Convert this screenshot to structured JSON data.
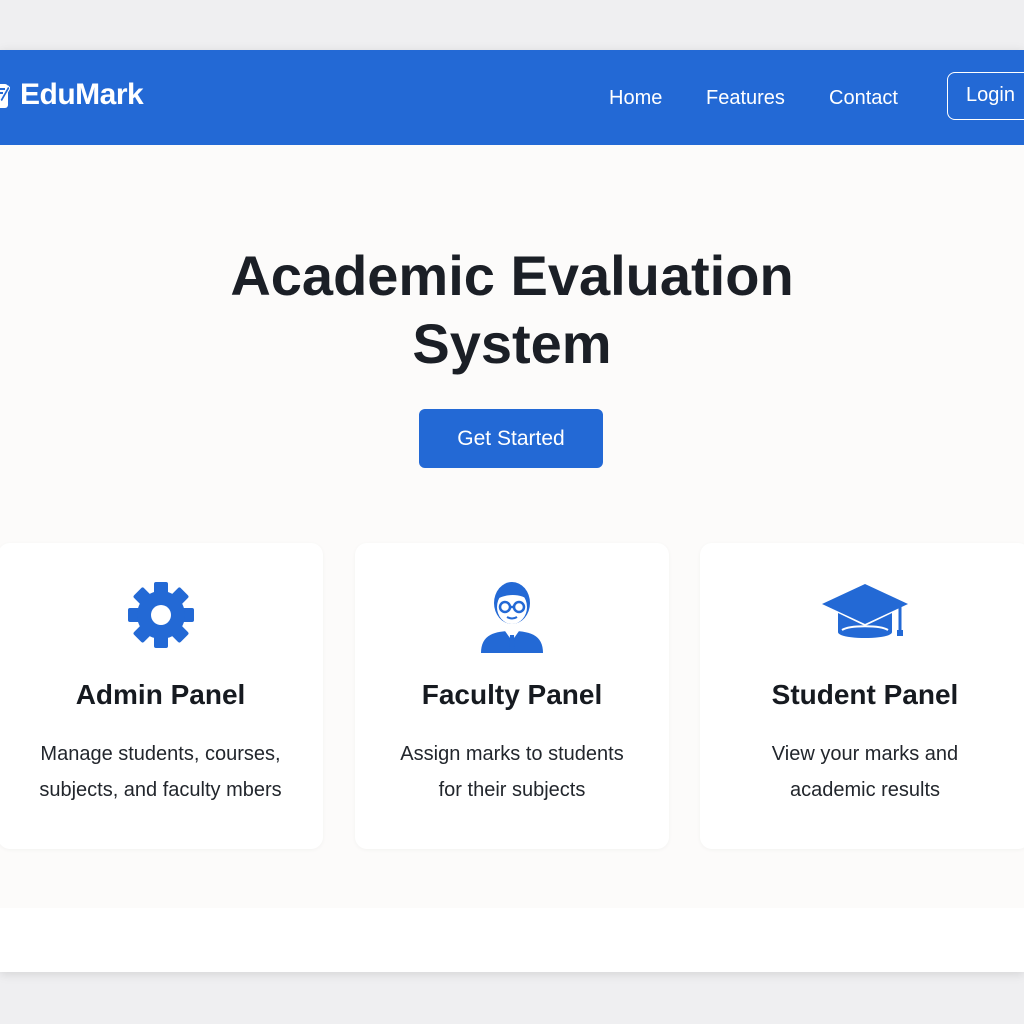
{
  "brand": {
    "name": "EduMark",
    "icon": "edit-note-icon"
  },
  "nav": {
    "links": [
      "Home",
      "Features",
      "Contact"
    ],
    "login_label": "Login"
  },
  "hero": {
    "title_line1": "Academic Evaluation",
    "title_line2": "System",
    "cta_label": "Get Started"
  },
  "cards": [
    {
      "icon": "gear-icon",
      "title": "Admin Panel",
      "desc_line1": "Manage students, courses,",
      "desc_line2": "subjects, and faculty mbers"
    },
    {
      "icon": "teacher-icon",
      "title": "Faculty Panel",
      "desc_line1": "Assign marks to students",
      "desc_line2": "for their subjects"
    },
    {
      "icon": "graduation-cap-icon",
      "title": "Student Panel",
      "desc_line1": "View your marks and",
      "desc_line2": "academic results"
    }
  ],
  "colors": {
    "primary": "#2369d5",
    "background": "#fcfbfa",
    "text_dark": "#1b1f26"
  }
}
